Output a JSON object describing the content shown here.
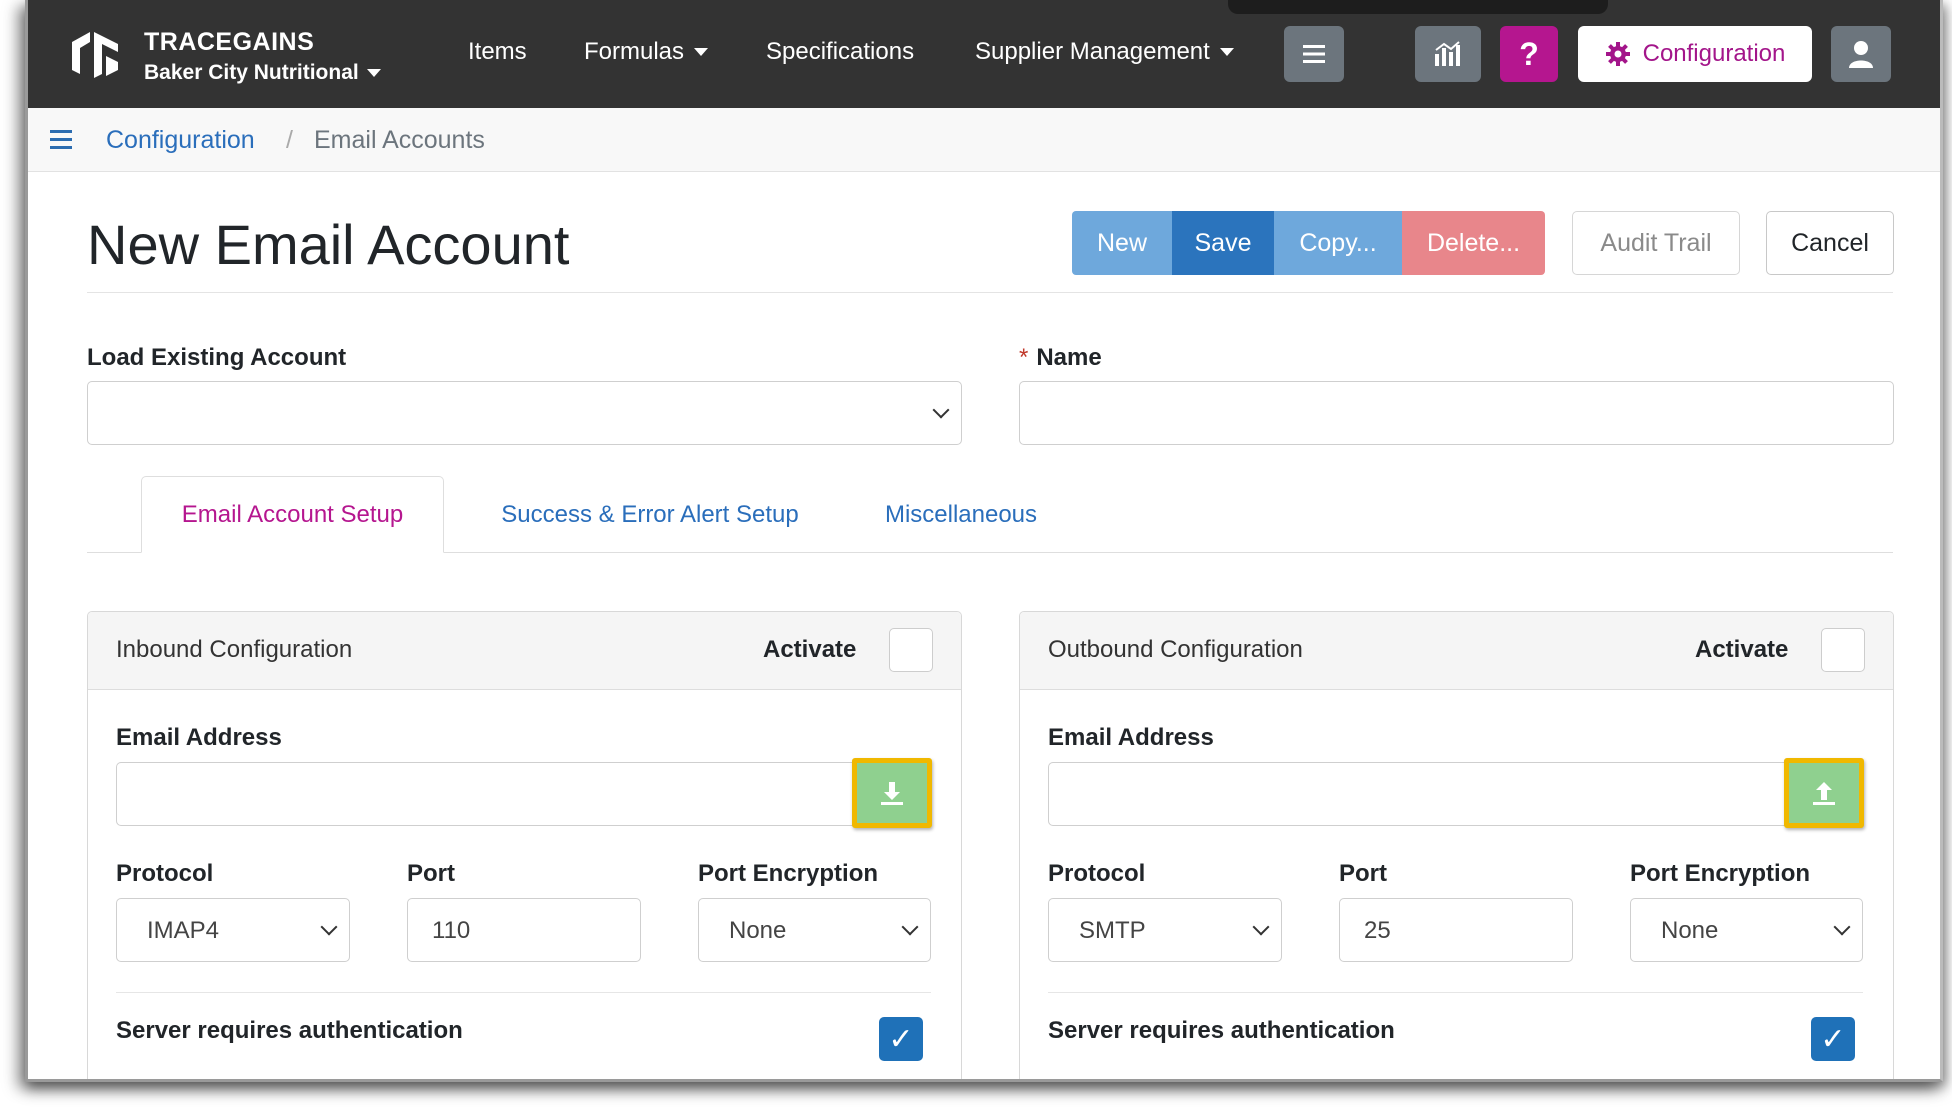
{
  "nav": {
    "brand": "TRACEGAINS",
    "company": "Baker City Nutritional",
    "items": [
      {
        "label": "Items"
      },
      {
        "label": "Formulas"
      },
      {
        "label": "Specifications"
      },
      {
        "label": "Supplier Management"
      }
    ],
    "help_label": "?",
    "config_label": "Configuration",
    "accent_color": "#b5168f"
  },
  "breadcrumb": {
    "parent": "Configuration",
    "separator": "/",
    "current": "Email Accounts"
  },
  "page": {
    "title": "New Email Account",
    "actions": {
      "new": "New",
      "save": "Save",
      "copy": "Copy...",
      "delete": "Delete...",
      "audit": "Audit Trail",
      "cancel": "Cancel"
    }
  },
  "form": {
    "load_label": "Load Existing Account",
    "load_value": "",
    "name_required": "*",
    "name_label": "Name",
    "name_value": ""
  },
  "tabs": [
    {
      "label": "Email Account Setup",
      "active": true
    },
    {
      "label": "Success & Error Alert Setup",
      "active": false
    },
    {
      "label": "Miscellaneous",
      "active": false
    }
  ],
  "inbound": {
    "title": "Inbound Configuration",
    "activate_label": "Activate",
    "activate_checked": false,
    "email_label": "Email Address",
    "email_value": "",
    "email_button_icon": "download-icon",
    "protocol_label": "Protocol",
    "protocol_value": "IMAP4",
    "port_label": "Port",
    "port_value": "110",
    "encryption_label": "Port Encryption",
    "encryption_value": "None",
    "auth_label": "Server requires authentication",
    "auth_checked": true
  },
  "outbound": {
    "title": "Outbound Configuration",
    "activate_label": "Activate",
    "activate_checked": false,
    "email_label": "Email Address",
    "email_value": "",
    "email_button_icon": "upload-icon",
    "protocol_label": "Protocol",
    "protocol_value": "SMTP",
    "port_label": "Port",
    "port_value": "25",
    "encryption_label": "Port Encryption",
    "encryption_value": "None",
    "auth_label": "Server requires authentication",
    "auth_checked": true
  }
}
